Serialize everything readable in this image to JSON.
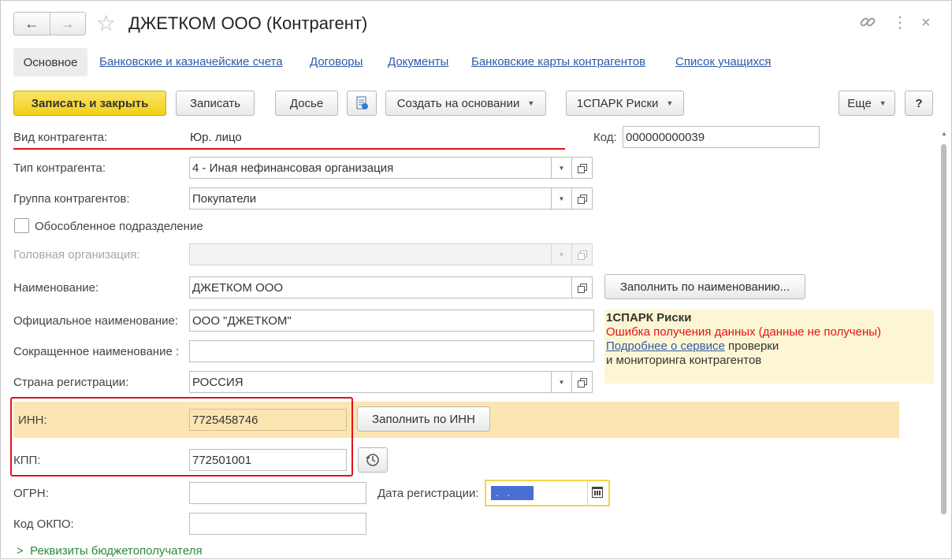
{
  "header": {
    "back_icon": "←",
    "forward_icon": "→",
    "title": "ДЖЕТКОМ ООО (Контрагент)",
    "link_icon": "🔗",
    "more_icon": "⋮",
    "close_icon": "×"
  },
  "tabs": [
    {
      "label": "Основное",
      "active": true
    },
    {
      "label": "Банковские и казначейские счета"
    },
    {
      "label": "Договоры"
    },
    {
      "label": "Документы"
    },
    {
      "label": "Банковские карты контрагентов"
    },
    {
      "label": "Список учащихся"
    }
  ],
  "toolbar": {
    "save_close": "Записать и закрыть",
    "save": "Записать",
    "dossier": "Досье",
    "create_based_on": "Создать на основании",
    "spark_risks": "1СПАРК Риски",
    "more": "Еще",
    "help": "?"
  },
  "form": {
    "kind_label": "Вид контрагента:",
    "kind_value": "Юр. лицо",
    "code_label": "Код:",
    "code_value": "000000000039",
    "type_label": "Тип контрагента:",
    "type_value": "4 - Иная нефинансовая организация",
    "group_label": "Группа контрагентов:",
    "group_value": "Покупатели",
    "separate_label": "Обособленное подразделение",
    "head_org_label": "Головная организация:",
    "head_org_value": "",
    "name_label": "Наименование:",
    "name_value": "ДЖЕТКОМ ООО",
    "fill_by_name": "Заполнить по наименованию...",
    "official_name_label": "Официальное наименование:",
    "official_name_value": "ООО \"ДЖЕТКОМ\"",
    "short_name_label": "Сокращенное наименование :",
    "short_name_value": "",
    "country_label": "Страна регистрации:",
    "country_value": "РОССИЯ",
    "inn_label": "ИНН:",
    "inn_value": "7725458746",
    "fill_by_inn": "Заполнить по ИНН",
    "kpp_label": "КПП:",
    "kpp_value": "772501001",
    "ogrn_label": "ОГРН:",
    "ogrn_value": "",
    "reg_date_label": "Дата регистрации:",
    "reg_date_value": ". .",
    "okpo_label": "Код ОКПО:",
    "okpo_value": "",
    "budget_link": "Реквизиты бюджетополучателя"
  },
  "spark_panel": {
    "title": "1СПАРК Риски",
    "error": "Ошибка получения данных (данные не получены)",
    "link": "Подробнее о сервисе",
    "text1": " проверки",
    "text2": "и мониторинга контрагентов"
  },
  "colors": {
    "accent_yellow": "#f2cf17",
    "highlight_red": "#e0131a",
    "link_blue": "#2e5aa8",
    "inn_band": "#fbe6b3"
  }
}
